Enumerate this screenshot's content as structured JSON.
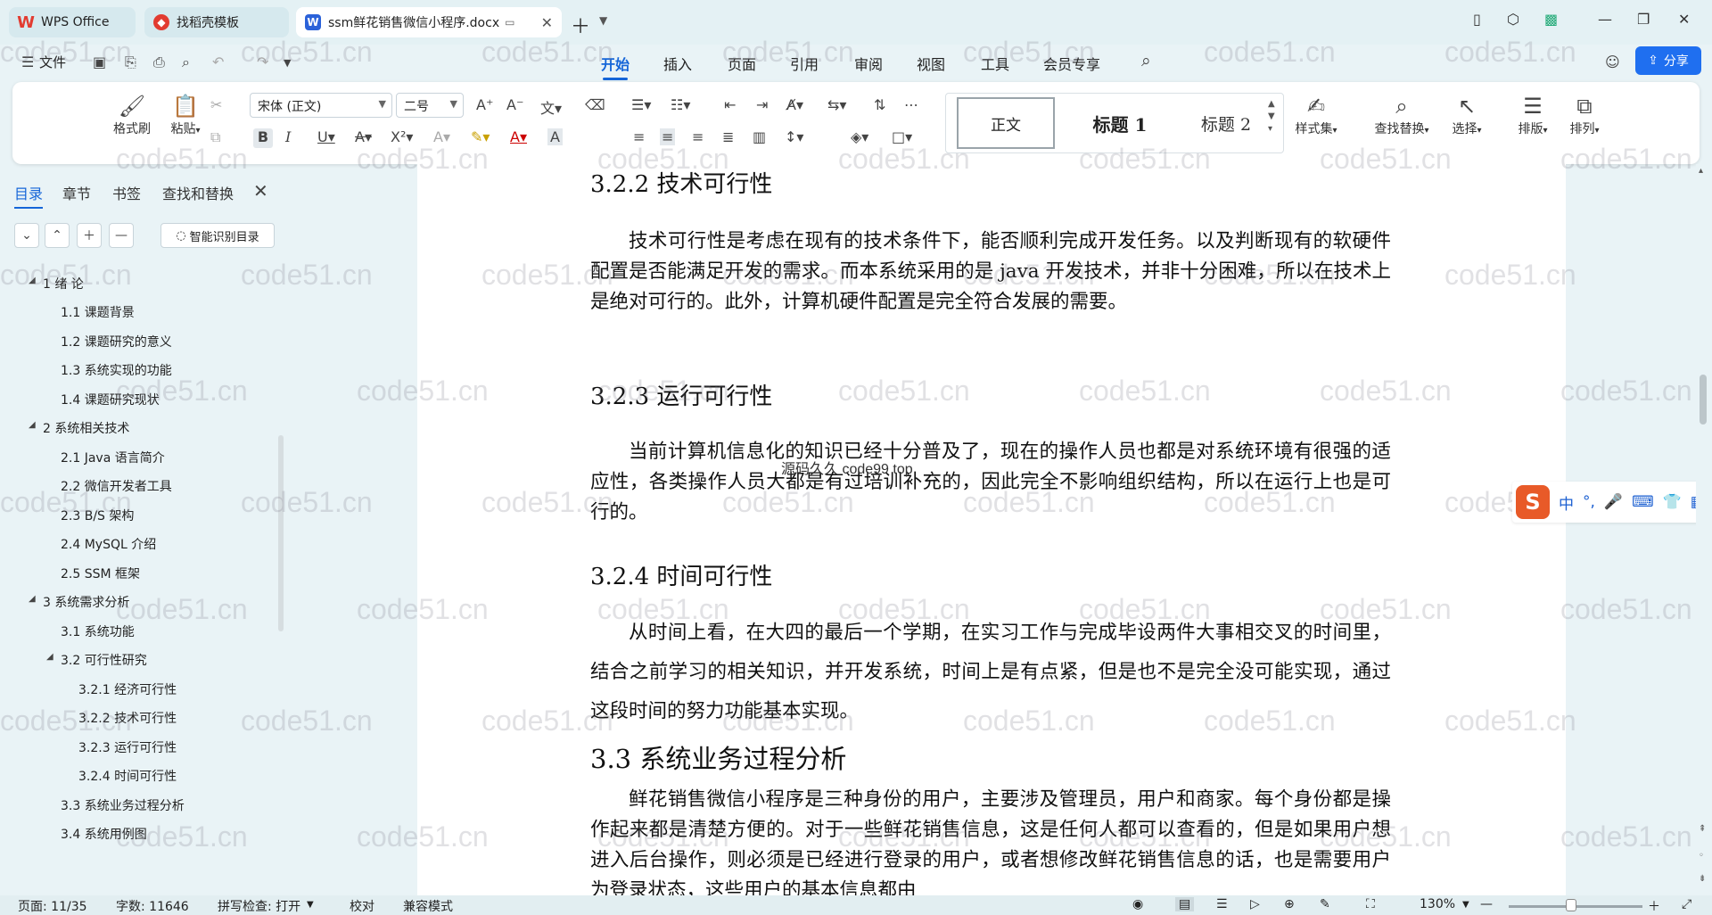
{
  "tabs": [
    {
      "label": "WPS Office",
      "icon": "wps-logo-icon"
    },
    {
      "label": "找稻壳模板",
      "icon": "docer-icon"
    },
    {
      "label": "ssm鲜花销售微信小程序.docx",
      "icon": "word-doc-icon"
    }
  ],
  "menu": {
    "file": "文件",
    "items": [
      "开始",
      "插入",
      "页面",
      "引用",
      "审阅",
      "视图",
      "工具",
      "会员专享"
    ],
    "share": "分享"
  },
  "ribbon": {
    "format_painter": "格式刷",
    "paste": "粘贴",
    "font": "宋体 (正文)",
    "size": "二号",
    "styles": {
      "normal": "正文",
      "h1": "标题 1",
      "h2": "标题 2"
    },
    "style_set": "样式集",
    "find_replace": "查找替换",
    "select": "选择",
    "layout": "排版",
    "arrange": "排列"
  },
  "sidebar": {
    "tabs": [
      "目录",
      "章节",
      "书签",
      "查找和替换"
    ],
    "smart_toc": "智能识别目录",
    "toc": [
      {
        "label": "1 绪  论",
        "level": 1,
        "expanded": true
      },
      {
        "label": "1.1  课题背景",
        "level": 2
      },
      {
        "label": "1.2  课题研究的意义",
        "level": 2
      },
      {
        "label": "1.3  系统实现的功能",
        "level": 2
      },
      {
        "label": "1.4  课题研究现状",
        "level": 2
      },
      {
        "label": "2 系统相关技术",
        "level": 1,
        "expanded": true
      },
      {
        "label": "2.1 Java 语言简介",
        "level": 2
      },
      {
        "label": "2.2 微信开发者工具",
        "level": 2
      },
      {
        "label": "2.3 B/S 架构",
        "level": 2
      },
      {
        "label": "2.4 MySQL  介绍",
        "level": 2
      },
      {
        "label": "2.5 SSM 框架",
        "level": 2
      },
      {
        "label": "3 系统需求分析",
        "level": 1,
        "expanded": true
      },
      {
        "label": "3.1 系统功能",
        "level": 2
      },
      {
        "label": "3.2 可行性研究",
        "level": 2,
        "expanded": true
      },
      {
        "label": "3.2.1  经济可行性",
        "level": 3
      },
      {
        "label": "3.2.2  技术可行性",
        "level": 3
      },
      {
        "label": "3.2.3  运行可行性",
        "level": 3
      },
      {
        "label": "3.2.4  时间可行性",
        "level": 3
      },
      {
        "label": "3.3 系统业务过程分析",
        "level": 2
      },
      {
        "label": "3.4 系统用例图",
        "level": 2
      }
    ]
  },
  "document": {
    "sections": [
      {
        "heading": "3.2.2  技术可行性",
        "paragraph": "技术可行性是考虑在现有的技术条件下，能否顺利完成开发任务。以及判断现有的软硬件配置是否能满足开发的需求。而本系统采用的是 java 开发技术，并非十分困难，所以在技术上是绝对可行的。此外，计算机硬件配置是完全符合发展的需要。"
      },
      {
        "heading": "3.2.3  运行可行性",
        "paragraph": "当前计算机信息化的知识已经十分普及了，现在的操作人员也都是对系统环境有很强的适应性，各类操作人员大都是有过培训补充的，因此完全不影响组织结构，所以在运行上也是可行的。"
      },
      {
        "heading": "3.2.4  时间可行性",
        "paragraph": "从时间上看，在大四的最后一个学期，在实习工作与完成毕设两件大事相交叉的时间里，结合之前学习的相关知识，并开发系统，时间上是有点紧，但是也不是完全没可能实现，通过这段时间的努力功能基本实现。"
      },
      {
        "heading": "3.3 系统业务过程分析",
        "paragraph": "鲜花销售微信小程序是三种身份的用户，主要涉及管理员，用户和商家。每个身份都是操作起来都是清楚方便的。对于一些鲜花销售信息，这是任何人都可以查看的，但是如果用户想进入后台操作，则必须是已经进行登录的用户，或者想修改鲜花销售信息的话，也是需要用户为登录状态，这些用户的基本信息都由"
      }
    ],
    "overlay_text": "源码久久 code99 top",
    "watermark": "code51.cn"
  },
  "ime": {
    "mode": "中"
  },
  "status": {
    "page": "页面: 11/35",
    "words": "字数: 11646",
    "spell": "拼写检查: 打开",
    "proof": "校对",
    "compat": "兼容模式",
    "zoom": "130%"
  },
  "colors": {
    "accent": "#1565d8",
    "share": "#1f6ff0",
    "ime_logo": "#e85a28",
    "wps_red": "#e23b30"
  }
}
